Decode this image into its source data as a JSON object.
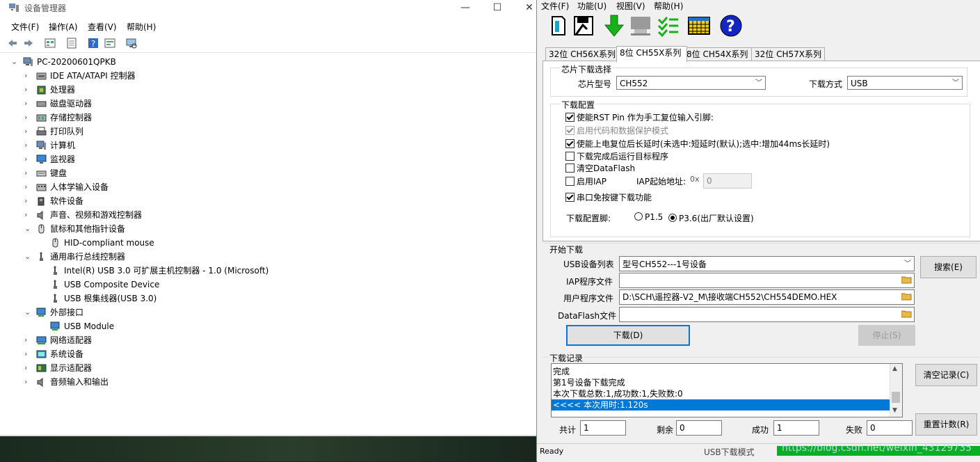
{
  "device_manager": {
    "title": "设备管理器",
    "menu": [
      "文件(F)",
      "操作(A)",
      "查看(V)",
      "帮助(H)"
    ],
    "tree": [
      {
        "label": "PC-20200601QPKB",
        "level": 0,
        "expand": "open",
        "icon": "computer-icon"
      },
      {
        "label": "IDE ATA/ATAPI 控制器",
        "level": 1,
        "expand": "closed",
        "icon": "ide-controller-icon"
      },
      {
        "label": "处理器",
        "level": 1,
        "expand": "closed",
        "icon": "processor-icon"
      },
      {
        "label": "磁盘驱动器",
        "level": 1,
        "expand": "closed",
        "icon": "disk-drive-icon"
      },
      {
        "label": "存储控制器",
        "level": 1,
        "expand": "closed",
        "icon": "storage-controller-icon"
      },
      {
        "label": "打印队列",
        "level": 1,
        "expand": "closed",
        "icon": "printer-icon"
      },
      {
        "label": "计算机",
        "level": 1,
        "expand": "closed",
        "icon": "computer-icon"
      },
      {
        "label": "监视器",
        "level": 1,
        "expand": "closed",
        "icon": "monitor-icon"
      },
      {
        "label": "键盘",
        "level": 1,
        "expand": "closed",
        "icon": "keyboard-icon"
      },
      {
        "label": "人体学输入设备",
        "level": 1,
        "expand": "closed",
        "icon": "hid-icon"
      },
      {
        "label": "软件设备",
        "level": 1,
        "expand": "closed",
        "icon": "software-device-icon"
      },
      {
        "label": "声音、视频和游戏控制器",
        "level": 1,
        "expand": "closed",
        "icon": "speaker-icon"
      },
      {
        "label": "鼠标和其他指针设备",
        "level": 1,
        "expand": "open",
        "icon": "mouse-icon"
      },
      {
        "label": "HID-compliant mouse",
        "level": 2,
        "expand": "none",
        "icon": "mouse-icon"
      },
      {
        "label": "通用串行总线控制器",
        "level": 1,
        "expand": "open",
        "icon": "usb-icon"
      },
      {
        "label": "Intel(R) USB 3.0 可扩展主机控制器 - 1.0 (Microsoft)",
        "level": 2,
        "expand": "none",
        "icon": "usb-icon"
      },
      {
        "label": "USB Composite Device",
        "level": 2,
        "expand": "none",
        "icon": "usb-icon"
      },
      {
        "label": "USB 根集线器(USB 3.0)",
        "level": 2,
        "expand": "none",
        "icon": "usb-icon"
      },
      {
        "label": "外部接口",
        "level": 1,
        "expand": "open",
        "icon": "external-interface-icon"
      },
      {
        "label": "USB Module",
        "level": 2,
        "expand": "none",
        "icon": "external-interface-icon"
      },
      {
        "label": "网络适配器",
        "level": 1,
        "expand": "closed",
        "icon": "network-adapter-icon"
      },
      {
        "label": "系统设备",
        "level": 1,
        "expand": "closed",
        "icon": "system-device-icon"
      },
      {
        "label": "显示适配器",
        "level": 1,
        "expand": "closed",
        "icon": "display-adapter-icon"
      },
      {
        "label": "音频输入和输出",
        "level": 1,
        "expand": "closed",
        "icon": "speaker-icon"
      }
    ]
  },
  "wch": {
    "menu": [
      "文件(F)",
      "功能(U)",
      "视图(V)",
      "帮助(H)"
    ],
    "tabs": [
      "32位 CH56X系列",
      "8位 CH55X系列",
      "8位 CH54X系列",
      "32位 CH57X系列"
    ],
    "chip_select": {
      "title": "芯片下载选择",
      "chip_label": "芯片型号",
      "chip_value": "CH552",
      "mode_label": "下载方式",
      "mode_value": "USB"
    },
    "config": {
      "title": "下载配置",
      "options": [
        {
          "label": "使能RST Pin 作为手工复位输入引脚:",
          "checked": true,
          "disabled": false
        },
        {
          "label": "启用代码和数据保护模式",
          "checked": true,
          "disabled": true
        },
        {
          "label": "使能上电复位后长延时(未选中:短延时(默认);选中:增加44ms长延时)",
          "checked": true,
          "disabled": false
        },
        {
          "label": "下载完成后运行目标程序",
          "checked": false,
          "disabled": false
        },
        {
          "label": "清空DataFlash",
          "checked": false,
          "disabled": false
        },
        {
          "label": "启用IAP",
          "checked": false,
          "disabled": false
        },
        {
          "label": "串口免按键下载功能",
          "checked": true,
          "disabled": false
        }
      ],
      "iap_addr_label": "IAP起始地址:",
      "iap_prefix": "0x",
      "iap_addr_value": "0",
      "pin_label": "下载配置脚:",
      "pin_options": [
        {
          "label": "P1.5",
          "selected": false
        },
        {
          "label": "P3.6(出厂默认设置)",
          "selected": true
        }
      ]
    },
    "download": {
      "title": "开始下载",
      "usb_list_label": "USB设备列表",
      "usb_list_value": "型号CH552---1号设备",
      "search_button": "搜索(E)",
      "iap_file_label": "IAP程序文件",
      "iap_file_value": "",
      "user_file_label": "用户程序文件",
      "user_file_value": "D:\\SCH\\遥控器-V2_M\\接收端CH552\\CH554DEMO.HEX",
      "dataflash_label": "DataFlash文件",
      "dataflash_value": "",
      "download_button": "下载(D)",
      "stop_button": "停止(S)"
    },
    "log": {
      "title": "下载记录",
      "lines": [
        "完成",
        "第1号设备下载完成",
        "本次下载总数:1,成功数:1,失败数:0",
        "<<<< 本次用时:1.120s"
      ],
      "clear_button": "清空记录(C)",
      "reset_button": "重置计数(R)"
    },
    "counters": {
      "total_label": "共计",
      "total": "1",
      "remain_label": "剩余",
      "remain": "0",
      "success_label": "成功",
      "success": "1",
      "fail_label": "失败",
      "fail": "0"
    },
    "status": {
      "ready": "Ready",
      "mode": "USB下载模式",
      "watermark": "https://blog.csdn.net/weixin_43129735"
    }
  }
}
